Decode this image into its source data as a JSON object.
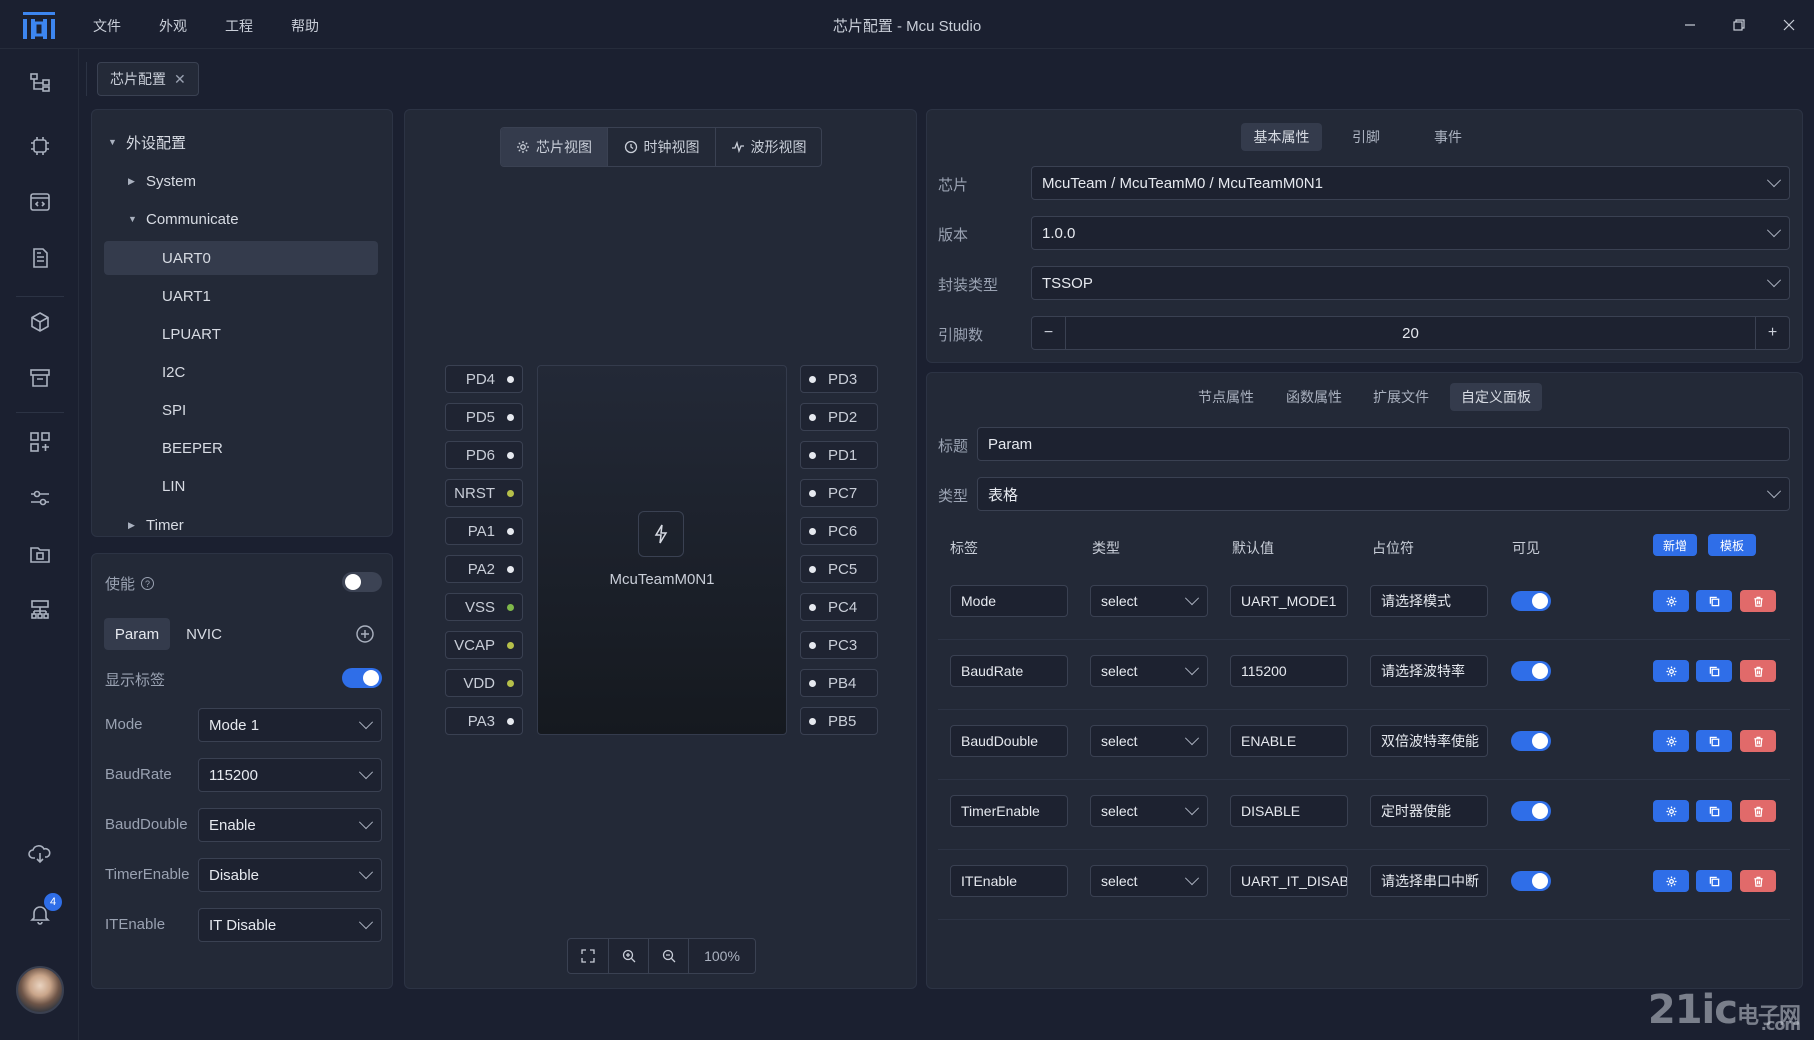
{
  "app": {
    "title": "芯片配置 - Mcu Studio",
    "menu": [
      "文件",
      "外观",
      "工程",
      "帮助"
    ]
  },
  "activity_bar": {
    "icons": [
      "flow-icon",
      "chip-icon",
      "code-window-icon",
      "document-icon",
      "cube-icon",
      "archive-icon",
      "layout-icon",
      "sliders-icon",
      "folder-chip-icon",
      "network-icon",
      "cloud-download-icon",
      "bell-icon"
    ],
    "notification_count": "4"
  },
  "tabs": [
    {
      "label": "芯片配置"
    }
  ],
  "tree": {
    "root": "外设配置",
    "items": [
      {
        "label": "System"
      },
      {
        "label": "Communicate"
      },
      {
        "label": "UART0"
      },
      {
        "label": "UART1"
      },
      {
        "label": "LPUART"
      },
      {
        "label": "I2C"
      },
      {
        "label": "SPI"
      },
      {
        "label": "BEEPER"
      },
      {
        "label": "LIN"
      },
      {
        "label": "Timer"
      }
    ]
  },
  "config": {
    "enable_label": "使能",
    "enable_on": false,
    "tabs": [
      "Param",
      "NVIC"
    ],
    "show_label": "显示标签",
    "show_label_on": true,
    "fields": [
      {
        "label": "Mode",
        "value": "Mode 1"
      },
      {
        "label": "BaudRate",
        "value": "115200"
      },
      {
        "label": "BaudDouble",
        "value": "Enable"
      },
      {
        "label": "TimerEnable",
        "value": "Disable"
      },
      {
        "label": "ITEnable",
        "value": "IT Disable"
      }
    ]
  },
  "chip_view": {
    "view_tabs": [
      "芯片视图",
      "时钟视图",
      "波形视图"
    ],
    "chip_name": "McuTeamM0N1",
    "left_pins": [
      {
        "name": "PD4",
        "color": "white"
      },
      {
        "name": "PD5",
        "color": "white"
      },
      {
        "name": "PD6",
        "color": "white"
      },
      {
        "name": "NRST",
        "color": "yellow"
      },
      {
        "name": "PA1",
        "color": "white"
      },
      {
        "name": "PA2",
        "color": "white"
      },
      {
        "name": "VSS",
        "color": "green"
      },
      {
        "name": "VCAP",
        "color": "yellow"
      },
      {
        "name": "VDD",
        "color": "yellow"
      },
      {
        "name": "PA3",
        "color": "white"
      }
    ],
    "right_pins": [
      {
        "name": "PD3",
        "color": "white"
      },
      {
        "name": "PD2",
        "color": "white"
      },
      {
        "name": "PD1",
        "color": "white"
      },
      {
        "name": "PC7",
        "color": "white"
      },
      {
        "name": "PC6",
        "color": "white"
      },
      {
        "name": "PC5",
        "color": "white"
      },
      {
        "name": "PC4",
        "color": "white"
      },
      {
        "name": "PC3",
        "color": "white"
      },
      {
        "name": "PB4",
        "color": "white"
      },
      {
        "name": "PB5",
        "color": "white"
      }
    ],
    "zoom": "100%"
  },
  "properties": {
    "tabs": [
      "基本属性",
      "引脚",
      "事件"
    ],
    "chip_label": "芯片",
    "chip_value": "McuTeam / McuTeamM0 / McuTeamM0N1",
    "version_label": "版本",
    "version_value": "1.0.0",
    "package_label": "封装类型",
    "package_value": "TSSOP",
    "pins_label": "引脚数",
    "pins_value": "20"
  },
  "node": {
    "tabs": [
      "节点属性",
      "函数属性",
      "扩展文件",
      "自定义面板"
    ],
    "title_label": "标题",
    "title_value": "Param",
    "type_label": "类型",
    "type_value": "表格",
    "columns": [
      "标签",
      "类型",
      "默认值",
      "占位符",
      "可见"
    ],
    "add_button": "新增",
    "template_button": "模板",
    "rows": [
      {
        "label": "Mode",
        "type": "select",
        "default": "UART_MODE1",
        "placeholder": "请选择模式",
        "visible": true
      },
      {
        "label": "BaudRate",
        "type": "select",
        "default": "115200",
        "placeholder": "请选择波特率",
        "visible": true
      },
      {
        "label": "BaudDouble",
        "type": "select",
        "default": "ENABLE",
        "placeholder": "双倍波特率使能",
        "visible": true
      },
      {
        "label": "TimerEnable",
        "type": "select",
        "default": "DISABLE",
        "placeholder": "定时器使能",
        "visible": true
      },
      {
        "label": "ITEnable",
        "type": "select",
        "default": "UART_IT_DISABLE",
        "placeholder": "请选择串口中断",
        "visible": true
      }
    ]
  },
  "watermark": {
    "main": "21ic",
    "sub": "电子网",
    "domain": ".com"
  },
  "colors": {
    "accent": "#2f6ee8",
    "danger": "#e16a6a",
    "background": "#1b2030",
    "panel": "#232937"
  }
}
